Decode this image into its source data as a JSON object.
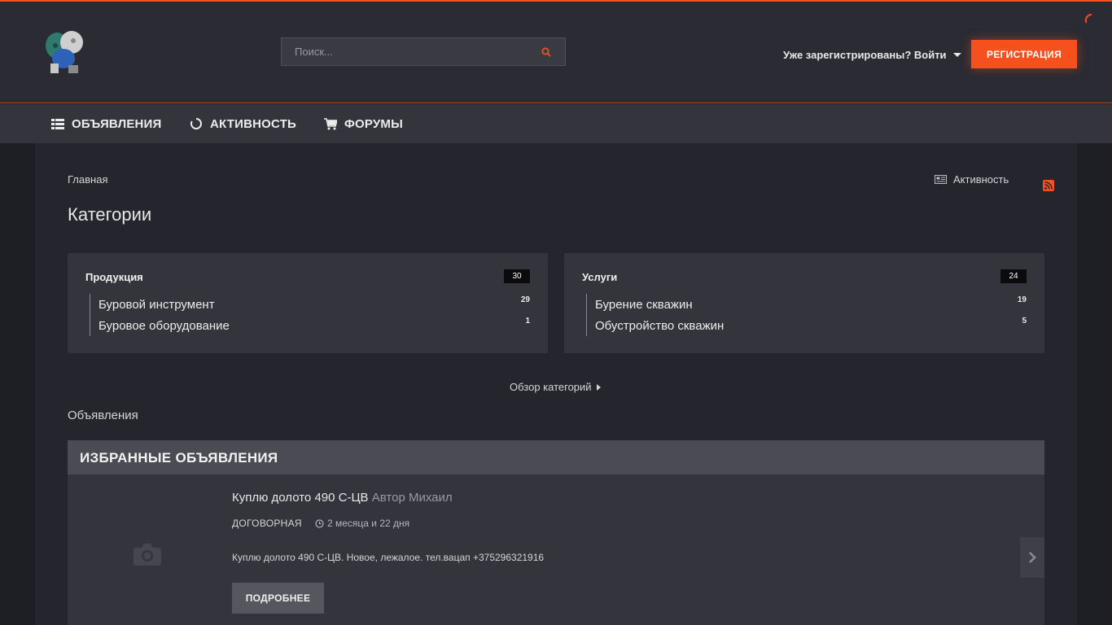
{
  "header": {
    "search_placeholder": "Поиск...",
    "login_text": "Уже зарегистрированы? Войти",
    "register_label": "РЕГИСТРАЦИЯ"
  },
  "nav": {
    "items": [
      {
        "label": "ОБЪЯВЛЕНИЯ",
        "icon": "list-icon"
      },
      {
        "label": "АКТИВНОСТЬ",
        "icon": "spinner-icon"
      },
      {
        "label": "ФОРУМЫ",
        "icon": "cart-icon"
      }
    ]
  },
  "breadcrumb": {
    "home": "Главная"
  },
  "activity_link": "Активность",
  "page_title": "Категории",
  "categories": [
    {
      "title": "Продукция",
      "count": "30",
      "subcategories": [
        {
          "label": "Буровой инструмент",
          "count": "29"
        },
        {
          "label": "Буровое оборудование",
          "count": "1"
        }
      ]
    },
    {
      "title": "Услуги",
      "count": "24",
      "subcategories": [
        {
          "label": "Бурение скважин",
          "count": "19"
        },
        {
          "label": "Обустройство скважин",
          "count": "5"
        }
      ]
    }
  ],
  "overview_link": "Обзор категорий",
  "ads_section_label": "Объявления",
  "featured": {
    "title": "ИЗБРАННЫЕ ОБЪЯВЛЕНИЯ",
    "ad": {
      "title": "Куплю долото 490 С-ЦВ",
      "author": "Автор Михаил",
      "price": "ДОГОВОРНАЯ",
      "time": "2 месяца и 22 дня",
      "description": "Куплю долото 490 С-ЦВ. Новое, лежалое. тел.вацап +375296321916",
      "more_label": "ПОДРОБНЕЕ"
    }
  },
  "colors": {
    "accent": "#f4511e",
    "background": "#1e1f25",
    "panel": "#34353c"
  }
}
